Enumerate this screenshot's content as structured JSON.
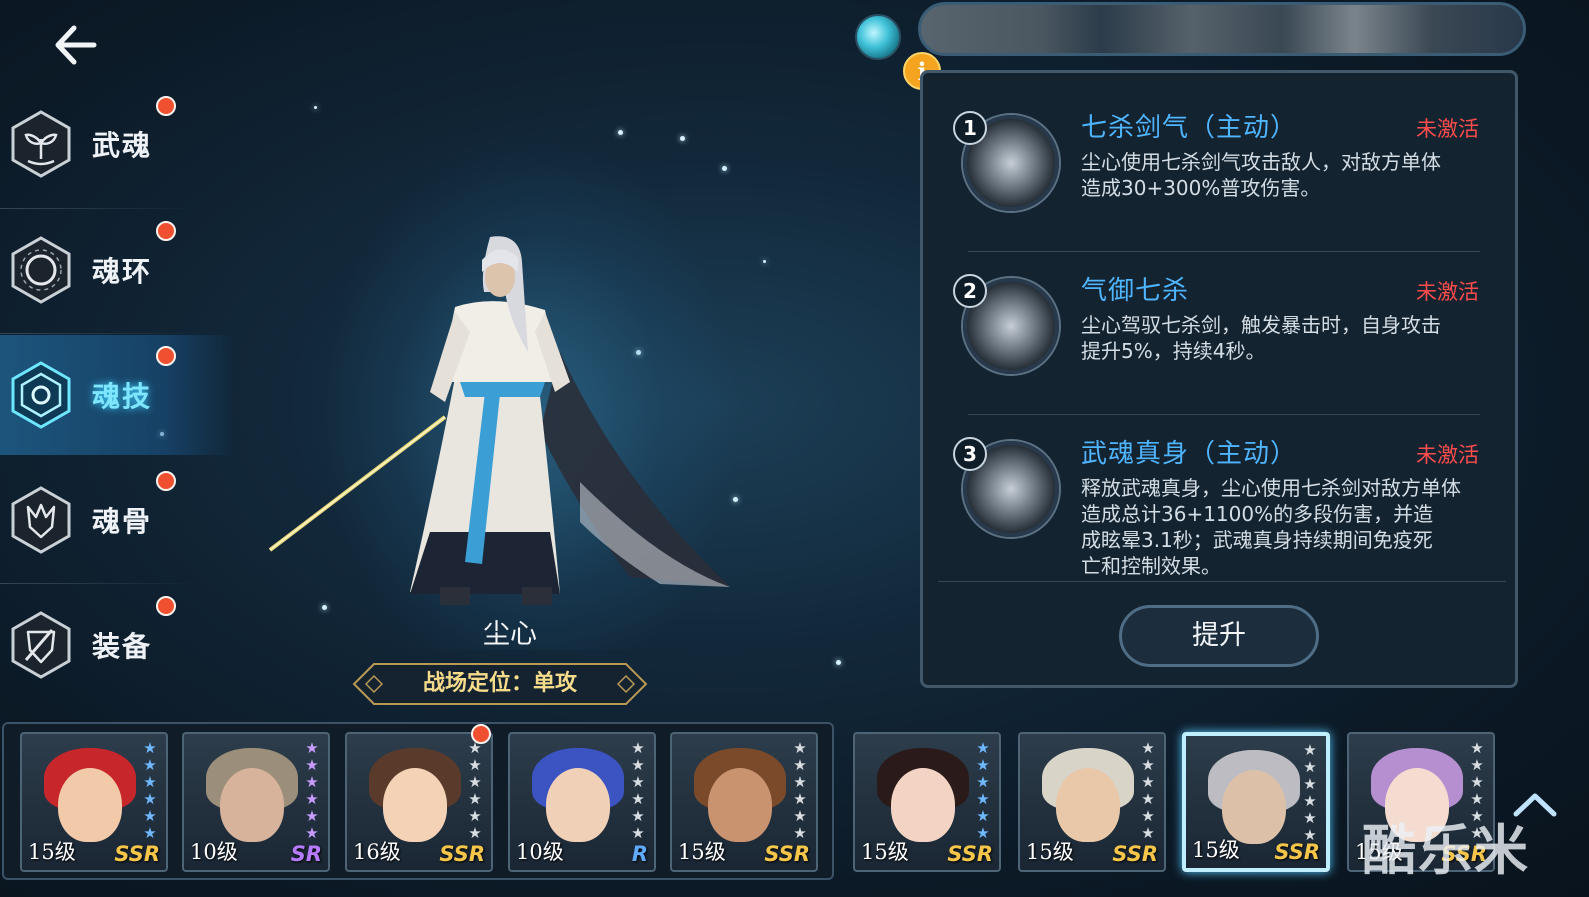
{
  "nav": {
    "back_icon": "back-arrow-icon"
  },
  "sidebar": {
    "items": [
      {
        "label": "武魂",
        "icon": "sprout-hex-icon",
        "badge": true,
        "active": false
      },
      {
        "label": "魂环",
        "icon": "ring-hex-icon",
        "badge": true,
        "active": false
      },
      {
        "label": "魂技",
        "icon": "skill-hex-icon",
        "badge": true,
        "active": true
      },
      {
        "label": "魂骨",
        "icon": "bone-hex-icon",
        "badge": true,
        "active": false
      },
      {
        "label": "装备",
        "icon": "shield-hex-icon",
        "badge": true,
        "active": false
      }
    ]
  },
  "hero": {
    "name": "尘心",
    "role_tag": "战场定位：单攻"
  },
  "resources": {
    "orb_icon": "soul-orb-icon",
    "info_label": "i"
  },
  "skills": {
    "items": [
      {
        "number": "1",
        "title": "七杀剑气（主动）",
        "status": "未激活",
        "desc_line1": "尘心使用七杀剑气攻击敌人，对敌方单体",
        "desc_line2": "造成30+300%普攻伤害。"
      },
      {
        "number": "2",
        "title": "气御七杀",
        "status": "未激活",
        "desc_line1": "尘心驾驭七杀剑，触发暴击时，自身攻击",
        "desc_line2": "提升5%，持续4秒。"
      },
      {
        "number": "3",
        "title": "武魂真身（主动）",
        "status": "未激活",
        "desc_line1": "释放武魂真身，尘心使用七杀剑对敌方单体",
        "desc_line2": "造成总计36+1100%的多段伤害，并造",
        "desc_line3": "成眩晕3.1秒；武魂真身持续期间免疫死",
        "desc_line4": "亡和控制效果。"
      }
    ],
    "upgrade_label": "提升"
  },
  "roster": {
    "cards": [
      {
        "level": "15级",
        "rarity": "SSR",
        "rarity_color": "#f5c64a",
        "stars": 6,
        "star_color": "#6fb8ff",
        "badge": false,
        "selected": false,
        "hair": "#c7272b",
        "skin": "#f2c9a9"
      },
      {
        "level": "10级",
        "rarity": "SR",
        "rarity_color": "#b67bff",
        "stars": 6,
        "star_color": "#c89bff",
        "badge": false,
        "selected": false,
        "hair": "#9b8e7a",
        "skin": "#d6b39a"
      },
      {
        "level": "16级",
        "rarity": "SSR",
        "rarity_color": "#f5c64a",
        "stars": 6,
        "star_color": "#d8dde2",
        "badge": true,
        "selected": false,
        "hair": "#5a3a2a",
        "skin": "#f4d2b6"
      },
      {
        "level": "10级",
        "rarity": "R",
        "rarity_color": "#5fa9ff",
        "stars": 6,
        "star_color": "#d8dde2",
        "badge": false,
        "selected": false,
        "hair": "#3b54c2",
        "skin": "#f1d0b8"
      },
      {
        "level": "15级",
        "rarity": "SSR",
        "rarity_color": "#f5c64a",
        "stars": 6,
        "star_color": "#d8dde2",
        "badge": false,
        "selected": false,
        "hair": "#7a4a2a",
        "skin": "#c9936f"
      },
      {
        "level": "15级",
        "rarity": "SSR",
        "rarity_color": "#f5c64a",
        "stars": 6,
        "star_color": "#6fb8ff",
        "badge": false,
        "selected": false,
        "hair": "#2a1a1a",
        "skin": "#f3d4c4"
      },
      {
        "level": "15级",
        "rarity": "SSR",
        "rarity_color": "#f5c64a",
        "stars": 6,
        "star_color": "#d8dde2",
        "badge": false,
        "selected": false,
        "hair": "#d9d4c8",
        "skin": "#e8c8a8"
      },
      {
        "level": "15级",
        "rarity": "SSR",
        "rarity_color": "#f5c64a",
        "stars": 6,
        "star_color": "#d8dde2",
        "badge": false,
        "selected": true,
        "hair": "#bcbcc2",
        "skin": "#dcc0a8"
      },
      {
        "level": "15级",
        "rarity": "SSR",
        "rarity_color": "#f5c64a",
        "stars": 6,
        "star_color": "#d8dde2",
        "badge": false,
        "selected": false,
        "hair": "#b58fcf",
        "skin": "#f4dcd0"
      }
    ]
  },
  "watermark": "酷乐米"
}
